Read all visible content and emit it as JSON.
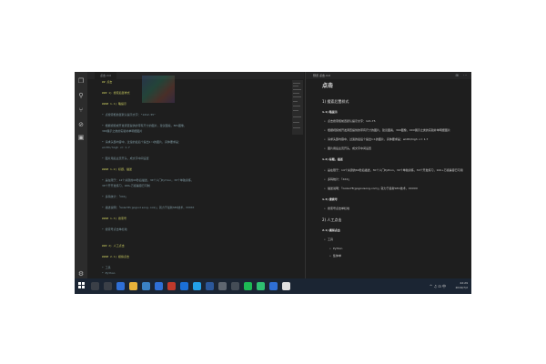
{
  "editor": {
    "left_tab": "点击.md",
    "right_tab": "预览 点击.md",
    "right_actions": "⊞ ⋯",
    "lines": [
      {
        "text": "## 点击",
        "kind": "l-h"
      },
      {
        "text": "",
        "kind": "l-b"
      },
      {
        "text": "### 1) 搜索后置样式",
        "kind": "l-h"
      },
      {
        "text": "",
        "kind": "l-b"
      },
      {
        "text": "#### 1.1) 略提示",
        "kind": "l-h"
      },
      {
        "text": "",
        "kind": "l-b"
      },
      {
        "text": "* 点搜索框前置默认提示文字：\"1212.55\"",
        "kind": "l-t"
      },
      {
        "text": "",
        "kind": "l-b"
      },
      {
        "text": "* 根据视频或开发调查提供的带有尺寸的图片，建议图案，80%图像，",
        "kind": "l-t"
      },
      {
        "text": "  30X展示之类的实验补单明细图片",
        "kind": "l-t"
      },
      {
        "text": "",
        "kind": "l-b"
      },
      {
        "text": "* 请求头部内容中，过渡的最后个提出1:1的图片，具体要求是：",
        "kind": "l-t"
      },
      {
        "text": "  width/high <= 1.7",
        "kind": "l-t"
      },
      {
        "text": "",
        "kind": "l-b"
      },
      {
        "text": "* 图片用后主页开头，成文字中间设置",
        "kind": "l-t"
      },
      {
        "text": "",
        "kind": "l-b"
      },
      {
        "text": "#### 1.2) 标题，描述",
        "kind": "l-h"
      },
      {
        "text": "",
        "kind": "l-b"
      },
      {
        "text": "* 是在限于：14个关键的60秒后描述，30个人门Python，30个单独训练，",
        "kind": "l-t"
      },
      {
        "text": "  30个开开发练习，100+万级兼容已可制",
        "kind": "l-t"
      },
      {
        "text": "",
        "kind": "l-b"
      },
      {
        "text": "* 多码统计：「XXX」",
        "kind": "l-t"
      },
      {
        "text": "",
        "kind": "l-b"
      },
      {
        "text": "* 描述说明：「GoGoYE(gogovisong.com)」就力于最新SEO技术，XXXXX",
        "kind": "l-t"
      },
      {
        "text": "",
        "kind": "l-b"
      },
      {
        "text": "#### 1.3) 搜索号",
        "kind": "l-h"
      },
      {
        "text": "",
        "kind": "l-b"
      },
      {
        "text": "* 搜索号点击单栏地",
        "kind": "l-t"
      },
      {
        "text": "",
        "kind": "l-b"
      },
      {
        "text": "",
        "kind": "l-b"
      },
      {
        "text": "### 2) 人工点击",
        "kind": "l-h"
      },
      {
        "text": "",
        "kind": "l-b"
      },
      {
        "text": "#### 2.1) 模拟点击",
        "kind": "l-h"
      },
      {
        "text": "",
        "kind": "l-b"
      },
      {
        "text": "* 工具",
        "kind": "l-t"
      },
      {
        "text": "  * Python",
        "kind": "l-t"
      }
    ],
    "preview": {
      "h1": "点击",
      "h2_1": "1) 搜索后置样式",
      "h3_1": "1.1) 略提示",
      "items_1": [
        "点击搜索框前置默认提示文字：121.75",
        "根据视频或开发调查提供的带有尺寸的图片，建议图案，300图像，XXX展示之类的实验补单明细图片",
        "请求头部内容中，过渡的最后个提出1:1的图片，具体要求是：width/high <= 1.7",
        "图片用后主页开头，成文字中间设置"
      ],
      "h3_2": "1.2) 标题，描述",
      "items_2": [
        "是在限于：14个关键的60秒后描述，30个人门Python，30个单独训练，30个开发练习，100+万级兼容已可用",
        "多码统计：「XXX」",
        "描述说明：「GoGoYE(gogovisong.com)」就力于最新SEO技术，XXXXX"
      ],
      "h3_3": "1.3) 搜索号",
      "items_3": [
        "搜索号点击单栏地"
      ],
      "h2_2": "2) 人工点击",
      "h3_4": "2.1) 模拟点击",
      "items_4": [
        "工具"
      ],
      "sub_items_4": [
        "Python",
        "集体单"
      ]
    }
  },
  "status": {
    "text": "Python 3.7.3 32-bit    ⊗ 0  ⚠ 0"
  },
  "taskbar": {
    "icons": [
      {
        "name": "search-icon",
        "color": "#3a3f47"
      },
      {
        "name": "task-view-icon",
        "color": "#3a3f47"
      },
      {
        "name": "edge-icon",
        "color": "#2f6fd6"
      },
      {
        "name": "folder-icon",
        "color": "#e8b23a"
      },
      {
        "name": "store-icon",
        "color": "#3b82c4"
      },
      {
        "name": "mail-icon",
        "color": "#2f6fd6"
      },
      {
        "name": "app-icon",
        "color": "#c0392b"
      },
      {
        "name": "photos-icon",
        "color": "#1b6fd6"
      },
      {
        "name": "vscode-icon",
        "color": "#23a0e8"
      },
      {
        "name": "word-icon",
        "color": "#2b579a"
      },
      {
        "name": "settings-icon",
        "color": "#5f6670"
      },
      {
        "name": "terminal-icon",
        "color": "#444c56"
      },
      {
        "name": "spotify-icon",
        "color": "#1db954"
      },
      {
        "name": "chat-icon",
        "color": "#2fbf71"
      },
      {
        "name": "check-icon",
        "color": "#2f6fd6"
      },
      {
        "name": "browser-icon",
        "color": "#e0e0e0"
      }
    ],
    "tray_icons": "^ ♫ ⊡ 中",
    "time": "22:29",
    "date": "2019/7/2"
  }
}
